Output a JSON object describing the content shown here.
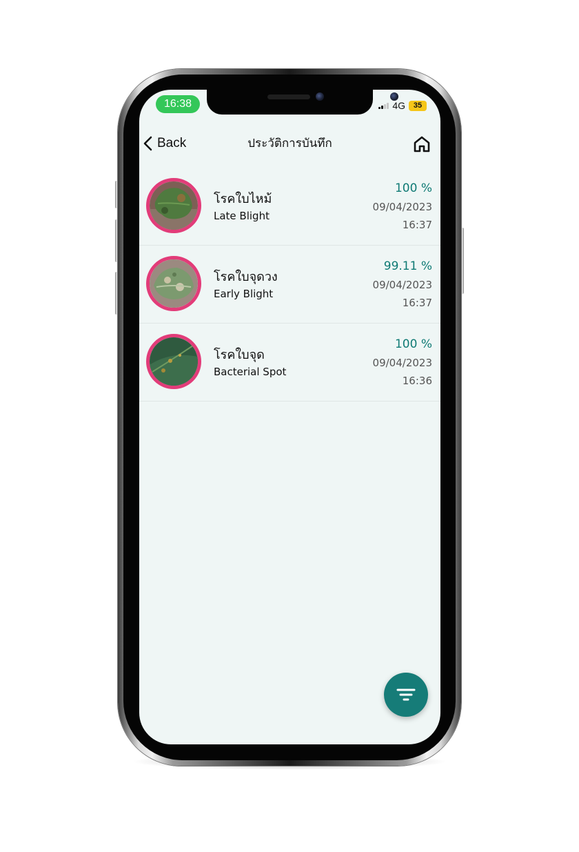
{
  "status_bar": {
    "time": "16:38",
    "network": "4G",
    "battery": "35",
    "time_pill_color": "#34c759",
    "battery_color": "#f5c518"
  },
  "header": {
    "back_label": "Back",
    "back_icon": "chevron-left-icon",
    "title": "ประวัติการบันทึก",
    "home_icon": "home-icon"
  },
  "records": [
    {
      "name_th": "โรคใบไหม้",
      "name_en": "Late Blight",
      "confidence": "100 %",
      "date": "09/04/2023",
      "time": "16:37"
    },
    {
      "name_th": "โรคใบจุดวง",
      "name_en": "Early Blight",
      "confidence": "99.11 %",
      "date": "09/04/2023",
      "time": "16:37"
    },
    {
      "name_th": "โรคใบจุด",
      "name_en": "Bacterial Spot",
      "confidence": "100 %",
      "date": "09/04/2023",
      "time": "16:36"
    }
  ],
  "fab": {
    "icon": "filter-icon",
    "color": "#167c78"
  },
  "colors": {
    "accent": "#0f7a74",
    "avatar_ring": "#e23c79",
    "screen_bg": "#eff6f5"
  }
}
